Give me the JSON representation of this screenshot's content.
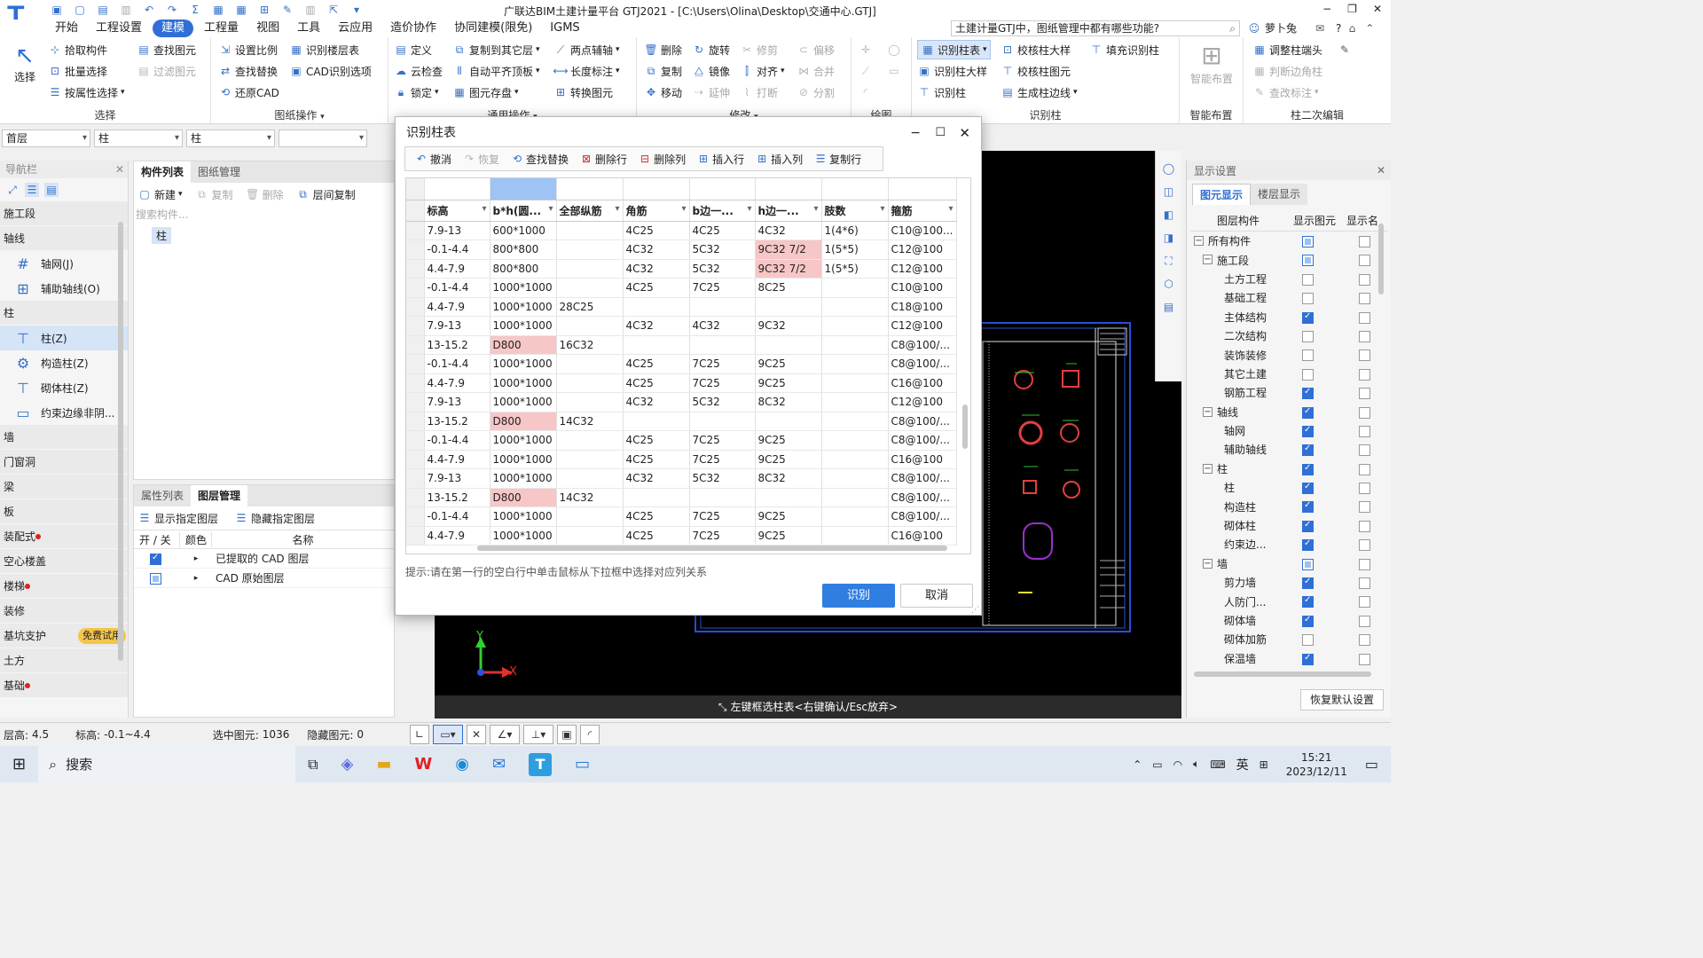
{
  "title": {
    "quick_icons": [
      "save-icon",
      "new-icon",
      "open-icon",
      "print-icon",
      "undo-icon",
      "redo-icon"
    ],
    "app_title": "广联达BIM土建计量平台 GTJ2021 - [C:\\Users\\Olina\\Desktop\\交通中心.GTJ]"
  },
  "menu": {
    "items": [
      "开始",
      "工程设置",
      "建模",
      "工程量",
      "视图",
      "工具",
      "云应用",
      "造价协作",
      "协同建模(限免)",
      "IGMS"
    ],
    "active_index": 2,
    "search_text": "土建计量GTJ中，图纸管理中都有哪些功能?",
    "user": "萝卜兔",
    "help": "?"
  },
  "ribbon": {
    "select": {
      "big": "选择",
      "items": [
        "拾取构件",
        "批量选择",
        "按属性选择"
      ],
      "items2": [
        "查找图元",
        "过滤图元"
      ],
      "label": "选择"
    },
    "drawing": {
      "items": [
        "设置比例",
        "查找替换",
        "还原CAD"
      ],
      "items2": [
        "识别楼层表",
        "CAD识别选项"
      ],
      "label": "图纸操作"
    },
    "general": {
      "items": [
        "定义",
        "云检查",
        "锁定"
      ],
      "items2": [
        "复制到其它层",
        "自动平齐顶板",
        "图元存盘"
      ],
      "items3": [
        "两点辅轴",
        "长度标注",
        "转换图元"
      ],
      "label": "通用操作"
    },
    "modify": {
      "items": [
        "删除",
        "复制",
        "移动"
      ],
      "items2": [
        "旋转",
        "镜像",
        "延伸"
      ],
      "items3": [
        "修剪",
        "对齐",
        "打断"
      ],
      "items4": [
        "偏移",
        "合并",
        "分割"
      ],
      "label": "修改"
    },
    "draw": {
      "label": "绘图"
    },
    "identify": {
      "items": [
        "识别柱表",
        "识别柱大样",
        "识别柱"
      ],
      "items2": [
        "校核柱大样",
        "校核柱图元",
        "生成柱边线"
      ],
      "items3": [
        "填充识别柱"
      ],
      "label": "识别柱"
    },
    "smart": {
      "big": "智能布置",
      "label": "智能布置"
    },
    "second": {
      "items": [
        "调整柱端头",
        "判断边角柱",
        "查改标注"
      ],
      "label": "柱二次编辑"
    }
  },
  "filters": [
    "首层",
    "柱",
    "柱",
    ""
  ],
  "nav": {
    "header": "导航栏",
    "categories": [
      {
        "label": "施工段",
        "dot": false,
        "subs": []
      },
      {
        "label": "轴线",
        "dot": false,
        "subs": [
          {
            "label": "轴网(J)",
            "icon": "grid-icon"
          },
          {
            "label": "辅助轴线(O)",
            "icon": "aux-grid-icon"
          }
        ]
      },
      {
        "label": "柱",
        "dot": false,
        "subs": [
          {
            "label": "柱(Z)",
            "icon": "column-icon",
            "active": true
          },
          {
            "label": "构造柱(Z)",
            "icon": "constructional-column-icon"
          },
          {
            "label": "砌体柱(Z)",
            "icon": "masonry-column-icon"
          },
          {
            "label": "约束边缘非阴...",
            "icon": "boundary-icon"
          }
        ]
      },
      {
        "label": "墙",
        "dot": false,
        "subs": []
      },
      {
        "label": "门窗洞",
        "dot": false,
        "subs": []
      },
      {
        "label": "梁",
        "dot": false,
        "subs": []
      },
      {
        "label": "板",
        "dot": false,
        "subs": []
      },
      {
        "label": "装配式",
        "dot": true,
        "subs": []
      },
      {
        "label": "空心楼盖",
        "dot": false,
        "subs": []
      },
      {
        "label": "楼梯",
        "dot": true,
        "subs": []
      },
      {
        "label": "装修",
        "dot": false,
        "subs": []
      },
      {
        "label": "基坑支护",
        "dot": false,
        "badge": "免费试用",
        "subs": []
      },
      {
        "label": "土方",
        "dot": false,
        "subs": []
      },
      {
        "label": "基础",
        "dot": true,
        "subs": []
      }
    ]
  },
  "components": {
    "tabs": [
      "构件列表",
      "图纸管理"
    ],
    "toolbar": [
      "新建",
      "复制",
      "删除",
      "层间复制"
    ],
    "search_placeholder": "搜索构件...",
    "tree_item": "柱"
  },
  "layers": {
    "tabs": [
      "属性列表",
      "图层管理"
    ],
    "toolbar": [
      "显示指定图层",
      "隐藏指定图层"
    ],
    "columns": [
      "开 / 关",
      "颜色",
      "名称"
    ],
    "rows": [
      {
        "on": true,
        "name": "已提取的 CAD 图层"
      },
      {
        "on": false,
        "name": "CAD 原始图层"
      }
    ]
  },
  "dialog": {
    "title": "识别柱表",
    "toolbar": [
      "撤消",
      "恢复",
      "查找替换",
      "删除行",
      "删除列",
      "插入行",
      "插入列",
      "复制行"
    ],
    "columns": [
      "标高",
      "b*h(圆...",
      "全部纵筋",
      "角筋",
      "b边一...",
      "h边一...",
      "肢数",
      "箍筋"
    ],
    "rows": [
      [
        "7.9-13",
        "600*1000",
        "",
        "4C25",
        "4C25",
        "4C32",
        "1(4*6)",
        "C10@100..."
      ],
      [
        "-0.1-4.4",
        "800*800",
        "",
        "4C32",
        "5C32",
        "9C32 7/2",
        "1(5*5)",
        "C12@100"
      ],
      [
        "4.4-7.9",
        "800*800",
        "",
        "4C32",
        "5C32",
        "9C32 7/2",
        "1(5*5)",
        "C12@100"
      ],
      [
        "-0.1-4.4",
        "1000*1000",
        "",
        "4C25",
        "7C25",
        "8C25",
        "",
        "C10@100"
      ],
      [
        "4.4-7.9",
        "1000*1000",
        "28C25",
        "",
        "",
        "",
        "",
        "C18@100"
      ],
      [
        "7.9-13",
        "1000*1000",
        "",
        "4C32",
        "4C32",
        "9C32",
        "",
        "C12@100"
      ],
      [
        "13-15.2",
        "D800",
        "16C32",
        "",
        "",
        "",
        "",
        "C8@100/..."
      ],
      [
        "-0.1-4.4",
        "1000*1000",
        "",
        "4C25",
        "7C25",
        "9C25",
        "",
        "C8@100/..."
      ],
      [
        "4.4-7.9",
        "1000*1000",
        "",
        "4C25",
        "7C25",
        "9C25",
        "",
        "C16@100"
      ],
      [
        "7.9-13",
        "1000*1000",
        "",
        "4C32",
        "5C32",
        "8C32",
        "",
        "C12@100"
      ],
      [
        "13-15.2",
        "D800",
        "14C32",
        "",
        "",
        "",
        "",
        "C8@100/..."
      ],
      [
        "-0.1-4.4",
        "1000*1000",
        "",
        "4C25",
        "7C25",
        "9C25",
        "",
        "C8@100/..."
      ],
      [
        "4.4-7.9",
        "1000*1000",
        "",
        "4C25",
        "7C25",
        "9C25",
        "",
        "C16@100"
      ],
      [
        "7.9-13",
        "1000*1000",
        "",
        "4C32",
        "5C32",
        "8C32",
        "",
        "C8@100/..."
      ],
      [
        "13-15.2",
        "D800",
        "14C32",
        "",
        "",
        "",
        "",
        "C8@100/..."
      ],
      [
        "-0.1-4.4",
        "1000*1000",
        "",
        "4C25",
        "7C25",
        "9C25",
        "",
        "C8@100/..."
      ],
      [
        "4.4-7.9",
        "1000*1000",
        "",
        "4C25",
        "7C25",
        "9C25",
        "",
        "C16@100"
      ]
    ],
    "highlights": [
      [
        1,
        5
      ],
      [
        2,
        5
      ],
      [
        6,
        1
      ],
      [
        10,
        1
      ],
      [
        14,
        1
      ]
    ],
    "hint": "提示:请在第一行的空白行中单击鼠标从下拉框中选择对应列关系",
    "ok": "识别",
    "cancel": "取消"
  },
  "canvas": {
    "prompt": "左键框选柱表<右键确认/Esc放弃>",
    "axis_y": "Y",
    "axis_x": "X"
  },
  "display": {
    "title": "显示设置",
    "tabs": [
      "图元显示",
      "楼层显示"
    ],
    "columns": [
      "图层构件",
      "显示图元",
      "显示名"
    ],
    "items": [
      {
        "label": "所有构件",
        "level": 0,
        "tree": "−",
        "show": "part",
        "name": false
      },
      {
        "label": "施工段",
        "level": 1,
        "tree": "−",
        "show": "part",
        "name": false
      },
      {
        "label": "土方工程",
        "level": 2,
        "show": "off",
        "name": false
      },
      {
        "label": "基础工程",
        "level": 2,
        "show": "off",
        "name": false
      },
      {
        "label": "主体结构",
        "level": 2,
        "show": "on",
        "name": false
      },
      {
        "label": "二次结构",
        "level": 2,
        "show": "off",
        "name": false
      },
      {
        "label": "装饰装修",
        "level": 2,
        "show": "off",
        "name": false
      },
      {
        "label": "其它土建",
        "level": 2,
        "show": "off",
        "name": false
      },
      {
        "label": "钢筋工程",
        "level": 2,
        "show": "on",
        "name": false
      },
      {
        "label": "轴线",
        "level": 1,
        "tree": "−",
        "show": "on",
        "name": false
      },
      {
        "label": "轴网",
        "level": 2,
        "show": "on",
        "name": false
      },
      {
        "label": "辅助轴线",
        "level": 2,
        "show": "on",
        "name": false
      },
      {
        "label": "柱",
        "level": 1,
        "tree": "−",
        "show": "on",
        "name": false
      },
      {
        "label": "柱",
        "level": 2,
        "show": "on",
        "name": false
      },
      {
        "label": "构造柱",
        "level": 2,
        "show": "on",
        "name": false
      },
      {
        "label": "砌体柱",
        "level": 2,
        "show": "on",
        "name": false
      },
      {
        "label": "约束边...",
        "level": 2,
        "show": "on",
        "name": false
      },
      {
        "label": "墙",
        "level": 1,
        "tree": "−",
        "show": "part",
        "name": false
      },
      {
        "label": "剪力墙",
        "level": 2,
        "show": "on",
        "name": false
      },
      {
        "label": "人防门...",
        "level": 2,
        "show": "on",
        "name": false
      },
      {
        "label": "砌体墙",
        "level": 2,
        "show": "on",
        "name": false
      },
      {
        "label": "砌体加筋",
        "level": 2,
        "show": "off",
        "name": false
      },
      {
        "label": "保温墙",
        "level": 2,
        "show": "on",
        "name": false
      }
    ],
    "restore": "恢复默认设置"
  },
  "status": {
    "floor_height_label": "层高:",
    "floor_height": "4.5",
    "elevation_label": "标高:",
    "elevation": "-0.1~4.4",
    "selected_label": "选中图元:",
    "selected": "1036",
    "hidden_label": "隐藏图元:",
    "hidden": "0"
  },
  "taskbar": {
    "search": "搜索",
    "ime": "英",
    "time": "15:21",
    "date": "2023/12/11"
  },
  "colors": {
    "accent": "#2f6fd6",
    "highlight": "#f7c6c6",
    "canvas_bg": "#000000"
  }
}
